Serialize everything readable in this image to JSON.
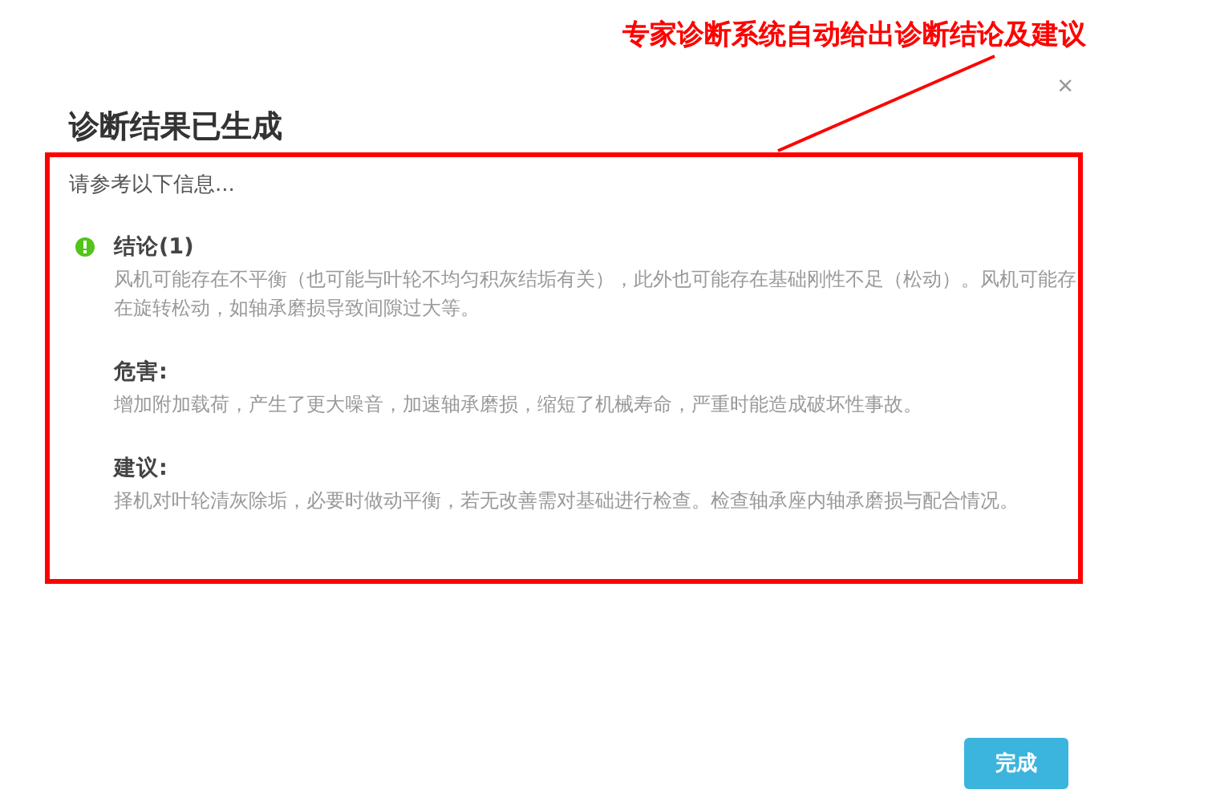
{
  "annotation": {
    "text": "专家诊断系统自动给出诊断结论及建议"
  },
  "dialog": {
    "close": "×",
    "title": "诊断结果已生成",
    "intro": "请参考以下信息...",
    "sections": [
      {
        "kind": "status",
        "heading": "结论(1)",
        "text": "风机可能存在不平衡（也可能与叶轮不均匀积灰结垢有关），此外也可能存在基础刚性不足（松动）。风机可能存在旋转松动，如轴承磨损导致间隙过大等。"
      },
      {
        "kind": "plain",
        "heading": "危害:",
        "text": "增加附加载荷，产生了更大噪音，加速轴承磨损，缩短了机械寿命，严重时能造成破坏性事故。"
      },
      {
        "kind": "plain",
        "heading": "建议:",
        "text": "择机对叶轮清灰除垢，必要时做动平衡，若无改善需对基础进行检查。检查轴承座内轴承磨损与配合情况。"
      }
    ],
    "button": "完成"
  }
}
